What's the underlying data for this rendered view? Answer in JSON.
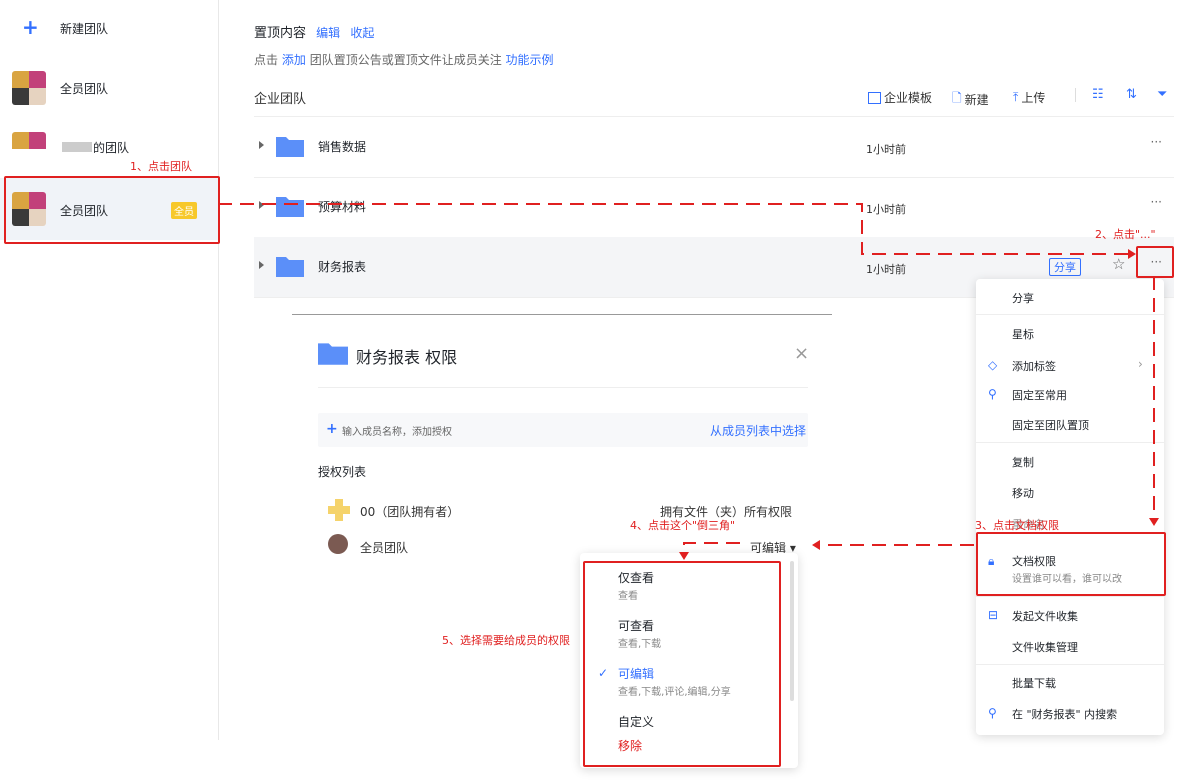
{
  "sidebar": {
    "new_team": "新建团队",
    "items": [
      {
        "label": "全员团队"
      },
      {
        "label": "的团队"
      },
      {
        "label": "全员团队",
        "badge": "全员"
      }
    ]
  },
  "pinned": {
    "title": "置顶内容",
    "edit": "编辑",
    "collapse": "收起",
    "hint_prefix": "点击",
    "hint_add": "添加",
    "hint_middle": "团队置顶公告或置顶文件让成员关注",
    "hint_example": "功能示例"
  },
  "section": {
    "title": "企业团队",
    "toolbar": {
      "template": "企业模板",
      "new": "新建",
      "upload": "上传"
    }
  },
  "files": [
    {
      "name": "销售数据",
      "time": "1小时前"
    },
    {
      "name": "预算材料",
      "time": "1小时前"
    },
    {
      "name": "财务报表",
      "time": "1小时前",
      "share": "分享"
    }
  ],
  "more_glyph": "···",
  "menu": {
    "items": [
      "分享",
      "星标",
      "添加标签",
      "固定至常用",
      "固定至团队置顶",
      "复制",
      "移动",
      "重命名",
      "文档权限",
      "设置谁可以看，谁可以改",
      "发起文件收集",
      "文件收集管理",
      "批量下载",
      "在 \"财务报表\" 内搜索"
    ]
  },
  "dialog": {
    "title": "财务报表 权限",
    "close": "×",
    "input_placeholder": "输入成员名称，添加授权",
    "select_from_list": "从成员列表中选择",
    "list_title": "授权列表",
    "members": [
      {
        "name": "00（团队拥有者）",
        "perm": "拥有文件（夹）所有权限"
      },
      {
        "name": "全员团队",
        "perm": "可编辑 ▾"
      }
    ]
  },
  "dropdown": {
    "options": [
      {
        "title": "仅查看",
        "desc": "查看"
      },
      {
        "title": "可查看",
        "desc": "查看,下载"
      },
      {
        "title": "可编辑",
        "desc": "查看,下载,评论,编辑,分享",
        "checked": "✓"
      },
      {
        "title": "自定义"
      }
    ],
    "remove": "移除"
  },
  "annotations": {
    "step1": "1、点击团队",
    "step2": "2、点击\"...\"",
    "step3": "3、点击文档权限",
    "step4": "4、点击这个\"倒三角\"",
    "step5": "5、选择需要给成员的权限"
  },
  "colors": {
    "accent": "#3370ff",
    "annotation": "#e02020",
    "folder": "#5b8ff9",
    "badge": "#f7c82b"
  }
}
